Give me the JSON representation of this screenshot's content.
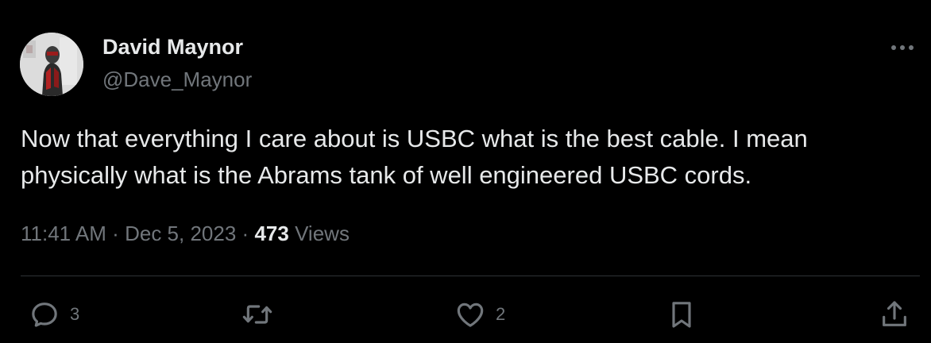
{
  "author": {
    "name": "David Maynor",
    "handle": "@Dave_Maynor"
  },
  "tweet": {
    "text": "Now that everything I care about is USBC what is the best cable. I mean physically what is the Abrams tank of well engineered USBC cords.",
    "time": "11:41 AM",
    "separator": "·",
    "date": "Dec 5, 2023",
    "views_count": "473",
    "views_label": "Views"
  },
  "actions": {
    "replies": "3",
    "likes": "2"
  },
  "icons": {
    "more": "more-icon",
    "reply": "reply-icon",
    "retweet": "retweet-icon",
    "like": "heart-icon",
    "bookmark": "bookmark-icon",
    "share": "share-icon"
  },
  "colors": {
    "background": "#000000",
    "text": "#e7e9ea",
    "secondary": "#71767b",
    "divider": "#2f3336"
  }
}
